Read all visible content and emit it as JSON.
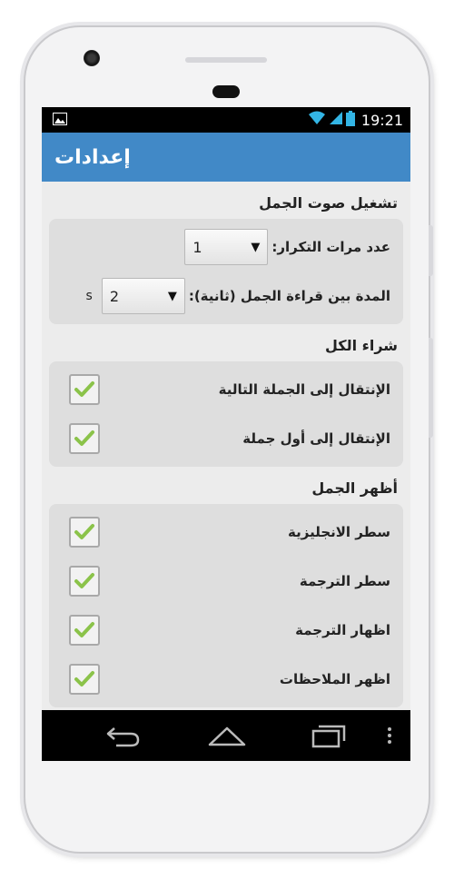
{
  "status_bar": {
    "time": "19:21"
  },
  "app_bar": {
    "title": "إعدادات"
  },
  "sections": {
    "play": {
      "title": "تشغيل صوت الجمل",
      "repeat": {
        "label": "عدد مرات التكرار:",
        "value": "1"
      },
      "interval": {
        "label": "المدة بين قراءة الجمل (ثانية):",
        "value": "2",
        "unit": "s"
      }
    },
    "buy": {
      "title": "شراء الكل",
      "items": [
        {
          "label": "الإنتقال إلى الجملة التالية",
          "checked": true
        },
        {
          "label": "الإنتقال إلى أول جملة",
          "checked": true
        }
      ]
    },
    "show": {
      "title": "أظهر الجمل",
      "items": [
        {
          "label": "سطر الانجليزية",
          "checked": true
        },
        {
          "label": "سطر الترجمة",
          "checked": true
        },
        {
          "label": "اظهار الترجمة",
          "checked": true
        },
        {
          "label": "اظهر الملاحظات",
          "checked": true
        }
      ]
    }
  },
  "colors": {
    "app_bar": "#4189c7",
    "check": "#8bc34a",
    "status_bar": "#000000"
  },
  "icons": {
    "status": [
      "image-icon",
      "wifi-icon",
      "signal-icon",
      "battery-icon"
    ],
    "nav": [
      "back-icon",
      "home-icon",
      "recents-icon",
      "menu-icon"
    ]
  }
}
